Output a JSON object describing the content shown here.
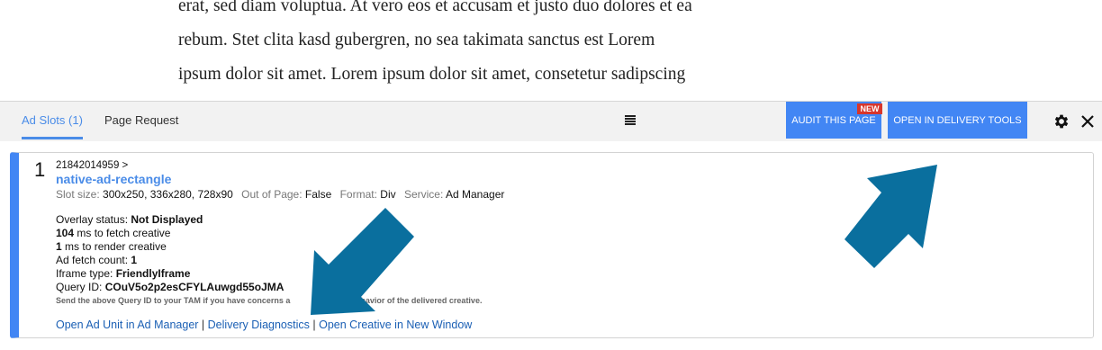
{
  "article": {
    "lines": [
      "erat, sed diam voluptua. At vero eos et accusam et justo duo dolores et ea",
      "rebum. Stet clita kasd gubergren, no sea takimata sanctus est Lorem",
      "ipsum dolor sit amet. Lorem ipsum dolor sit amet, consetetur sadipscing"
    ]
  },
  "toolbar": {
    "tabs": [
      {
        "label": "Ad Slots (1)",
        "active": true
      },
      {
        "label": "Page Request",
        "active": false
      }
    ],
    "audit_button": "AUDIT THIS PAGE",
    "new_badge": "NEW",
    "delivery_button": "OPEN IN DELIVERY TOOLS",
    "icons": [
      "list-icon",
      "gear-icon",
      "close-icon"
    ]
  },
  "slot": {
    "number": "1",
    "network": "21842014959 >",
    "ad_unit": "native-ad-rectangle",
    "slot_size_label": "Slot size:",
    "slot_size": "300x250, 336x280, 728x90",
    "out_of_page_label": "Out of Page:",
    "out_of_page": "False",
    "format_label": "Format:",
    "format": "Div",
    "service_label": "Service:",
    "service": "Ad Manager",
    "overlay_label": "Overlay status:",
    "overlay_value": "Not Displayed",
    "fetch_ms": "104",
    "fetch_text": "ms to fetch creative",
    "render_ms": "1",
    "render_text": "ms to render creative",
    "fetch_count_label": "Ad fetch count:",
    "fetch_count": "1",
    "iframe_label": "Iframe type:",
    "iframe_value": "FriendlyIframe",
    "query_label": "Query ID:",
    "query_value": "COuV5o2p2esCFYLAuwgd55oJMA",
    "note": "Send the above Query ID to your TAM if you have concerns a",
    "note_tail": "ent or behavior of the delivered creative.",
    "links": [
      "Open Ad Unit in Ad Manager",
      "Delivery Diagnostics",
      "Open Creative in New Window"
    ],
    "separator": "|"
  },
  "colors": {
    "accent": "#4286f4",
    "link": "#1a5fb4",
    "badge": "#d8362b",
    "arrow": "#0a6f9e"
  }
}
